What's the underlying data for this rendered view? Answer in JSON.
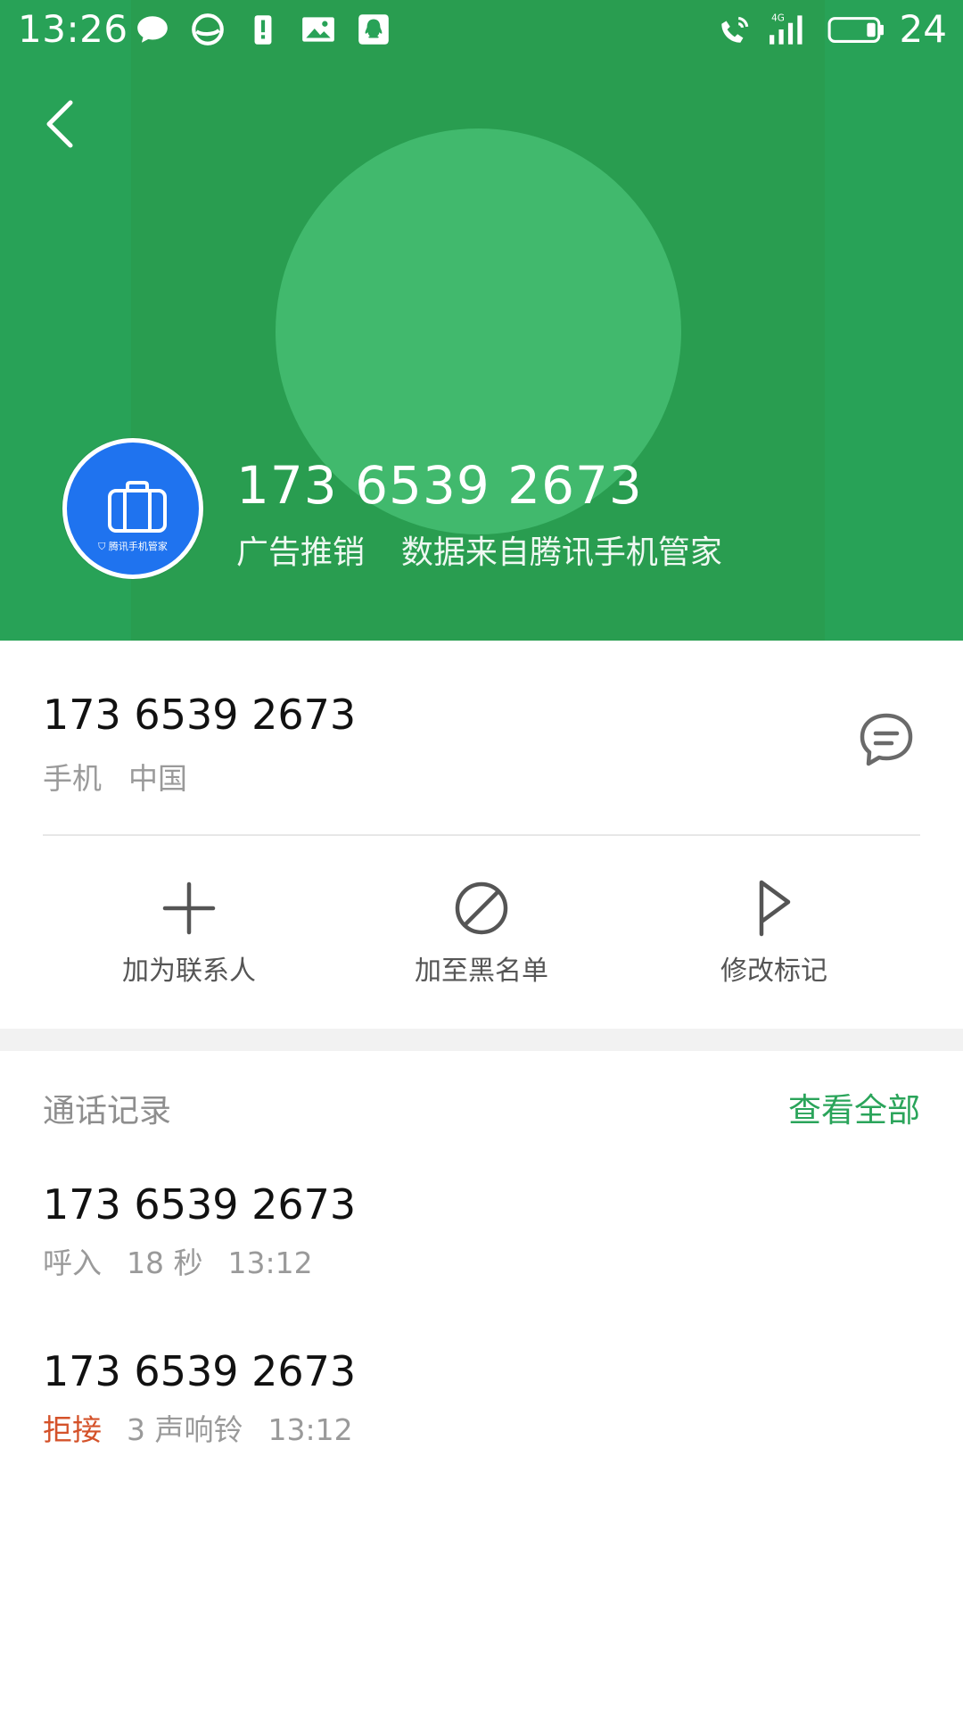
{
  "status_bar": {
    "time": "13:26",
    "battery_level": "24",
    "network": "4G"
  },
  "header": {
    "phone_number": "173 6539 2673",
    "tag_label": "广告推销",
    "tag_source": "数据来自腾讯手机管家",
    "tag_brand": "腾讯手机管家",
    "colors": {
      "background": "#28a257",
      "circle": "#41b96d",
      "avatar": "#1f73ef"
    }
  },
  "info": {
    "phone_number": "173 6539 2673",
    "type": "手机",
    "region": "中国"
  },
  "actions": [
    {
      "label": "加为联系人",
      "icon": "plus-icon"
    },
    {
      "label": "加至黑名单",
      "icon": "block-icon"
    },
    {
      "label": "修改标记",
      "icon": "flag-icon"
    }
  ],
  "records": {
    "title": "通话记录",
    "view_all": "查看全部",
    "items": [
      {
        "number": "173 6539 2673",
        "kind": "呼入",
        "detail": "18 秒",
        "time": "13:12"
      },
      {
        "number": "173 6539 2673",
        "kind": "拒接",
        "detail": "3 声响铃",
        "time": "13:12"
      }
    ],
    "colors": {
      "view_all": "#2aa45a",
      "reject": "#d4522a"
    }
  }
}
